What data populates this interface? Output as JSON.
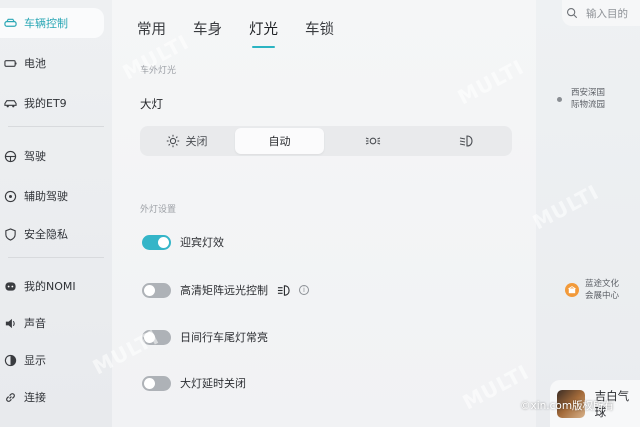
{
  "sidebar": {
    "items": [
      {
        "label": "车辆控制",
        "icon": "car-control-icon",
        "active": true
      },
      {
        "label": "电池",
        "icon": "battery-icon"
      },
      {
        "label": "我的ET9",
        "icon": "car-icon"
      },
      {
        "label": "驾驶",
        "icon": "steering-wheel-icon"
      },
      {
        "label": "辅助驾驶",
        "icon": "assisted-driving-icon"
      },
      {
        "label": "安全隐私",
        "icon": "shield-icon"
      },
      {
        "label": "我的NOMI",
        "icon": "nomi-icon"
      },
      {
        "label": "声音",
        "icon": "speaker-icon"
      },
      {
        "label": "显示",
        "icon": "display-icon"
      },
      {
        "label": "连接",
        "icon": "link-icon"
      }
    ]
  },
  "tabs": [
    {
      "label": "常用"
    },
    {
      "label": "车身"
    },
    {
      "label": "灯光",
      "active": true
    },
    {
      "label": "车锁"
    }
  ],
  "exterior_lights": {
    "section_label": "车外灯光",
    "headlight_title": "大灯",
    "options": [
      {
        "label": "关闭",
        "icon": "sun-icon"
      },
      {
        "label": "自动",
        "selected": true
      },
      {
        "label": "",
        "icon": "position-light-icon"
      },
      {
        "label": "",
        "icon": "low-beam-icon"
      }
    ]
  },
  "exterior_settings": {
    "section_label": "外灯设置",
    "toggles": [
      {
        "label": "迎宾灯效",
        "on": true
      },
      {
        "label": "高清矩阵远光控制",
        "on": false,
        "icon": "high-beam-icon",
        "info": "i"
      },
      {
        "label": "日间行车尾灯常亮",
        "on": false
      },
      {
        "label": "大灯延时关闭",
        "on": false
      }
    ]
  },
  "map": {
    "search_placeholder": "输入目的",
    "poi_1_line1": "西安深国",
    "poi_1_line2": "际物流园",
    "poi_2_line1": "蓝途文化",
    "poi_2_line2": "会展中心"
  },
  "media": {
    "title": "吉白气球"
  },
  "watermark": {
    "text": "©xin.com版权所有",
    "logo_line1": "MULTI",
    "logo_line2": "MOTORS"
  },
  "colors": {
    "accent": "#2bb4c2",
    "toggle_on": "#34b5c8",
    "toggle_off": "#aeb2b7",
    "poi_badge": "#f29a3a"
  }
}
